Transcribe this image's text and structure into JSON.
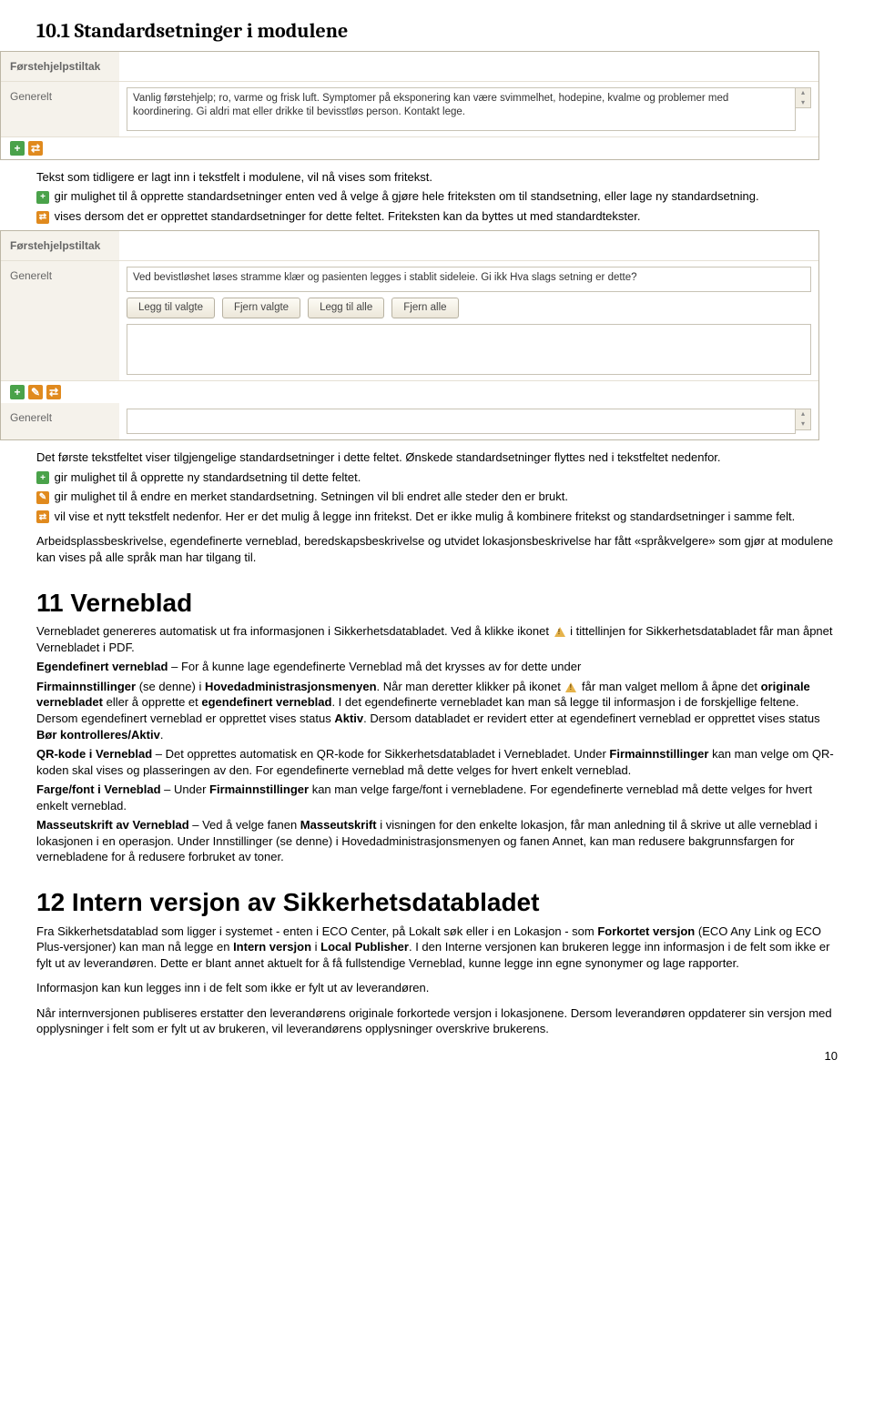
{
  "section_10_1": {
    "heading": "10.1 Standardsetninger i modulene",
    "panel1": {
      "title_label": "Førstehjelpstiltak",
      "row_label": "Generelt",
      "textarea": "Vanlig førstehjelp; ro, varme og frisk luft. Symptomer på eksponering kan være svimmelhet, hodepine, kvalme og problemer med koordinering. Gi aldri mat eller drikke til bevisstløs person. Kontakt lege."
    },
    "p1": "Tekst som tidligere er lagt inn i tekstfelt i modulene, vil nå vises som fritekst.",
    "p2a": " gir mulighet til å opprette standardsetninger enten ved å velge å gjøre hele friteksten om til standsetning, eller lage ny standardsetning.",
    "p3a": " vises dersom det er opprettet standardsetninger for dette feltet. Friteksten kan da byttes ut med standardtekster.",
    "panel2": {
      "title_label": "Førstehjelpstiltak",
      "row_label": "Generelt",
      "textarea": "Ved bevistløshet løses stramme klær og pasienten legges i stablit sideleie. Gi ikk Hva slags setning er dette?",
      "btn1": "Legg til valgte",
      "btn2": "Fjern valgte",
      "btn3": "Legg til alle",
      "btn4": "Fjern alle",
      "row_label2": "Generelt"
    },
    "p4": "Det første tekstfeltet viser tilgjengelige standardsetninger i dette feltet. Ønskede standardsetninger flyttes ned i tekstfeltet nedenfor.",
    "p5": " gir mulighet til å opprette ny standardsetning til dette feltet.",
    "p6": " gir mulighet til å endre en merket standardsetning. Setningen vil bli endret alle steder den er brukt.",
    "p7": " vil vise et nytt tekstfelt nedenfor. Her er det mulig å legge inn fritekst. Det er ikke mulig å kombinere fritekst og standardsetninger i samme felt.",
    "p8": "Arbeidsplassbeskrivelse, egendefinerte verneblad, beredskapsbeskrivelse og utvidet lokasjonsbeskrivelse har fått «språkvelgere» som gjør at modulene kan vises på alle språk man har tilgang til."
  },
  "section_11": {
    "heading": "11 Verneblad",
    "p1a": "Vernebladet genereres automatisk ut fra informasjonen i Sikkerhetsdatabladet. Ved å klikke ikonet ",
    "p1b": " i tittellinjen for Sikkerhetsdatabladet får man åpnet Vernebladet i PDF.",
    "p2_b": "Egendefinert verneblad",
    "p2": " – For å kunne lage egendefinerte Verneblad må det krysses av for dette under ",
    "p3_b1": "Firmainnstillinger",
    "p3a": " (se denne) i ",
    "p3_b2": "Hovedadministrasjonsmenyen",
    "p3b": ". Når man deretter klikker på ikonet ",
    "p3c": " får man valget mellom å åpne det ",
    "p3_b3": "originale vernebladet",
    "p3d": " eller å opprette et ",
    "p3_b4": "egendefinert verneblad",
    "p3e": ". I det egendefinerte vernebladet kan man så legge til informasjon i de forskjellige feltene. Dersom egendefinert verneblad er opprettet vises status ",
    "p3_b5": "Aktiv",
    "p3f": ". Dersom databladet er revidert etter at egendefinert verneblad er opprettet vises status ",
    "p3_b6": "Bør kontrolleres/Aktiv",
    "p3g": ".",
    "p4_b": "QR-kode i Verneblad",
    "p4a": " – Det opprettes automatisk en QR-kode for Sikkerhetsdatabladet i Vernebladet. Under ",
    "p4_b2": "Firmainnstillinger",
    "p4b": " kan man velge om QR-koden skal vises og plasseringen av den. For egendefinerte verneblad må dette velges for hvert enkelt verneblad.",
    "p5_b": "Farge/font i Verneblad",
    "p5a": " – Under ",
    "p5_b2": "Firmainnstillinger",
    "p5b": " kan man velge farge/font i vernebladene. For egendefinerte verneblad må dette velges for hvert enkelt verneblad.",
    "p6_b": "Masseutskrift av Verneblad",
    "p6a": " – Ved å velge fanen ",
    "p6_b2": "Masseutskrift",
    "p6b": " i visningen for den enkelte lokasjon, får man anledning til å skrive ut alle verneblad i lokasjonen i en operasjon. Under Innstillinger (se denne) i Hovedadministrasjonsmenyen og fanen Annet, kan man redusere bakgrunnsfargen for vernebladene for å redusere forbruket av toner."
  },
  "section_12": {
    "heading": "12 Intern versjon av Sikkerhetsdatabladet",
    "p1a": "Fra Sikkerhetsdatablad som ligger i systemet - enten i ECO Center, på Lokalt søk eller i en Lokasjon - som ",
    "p1_b1": "Forkortet versjon",
    "p1b": " (ECO Any Link og ECO Plus-versjoner) kan man nå legge en ",
    "p1_b2": "Intern versjon",
    "p1c": " i ",
    "p1_b3": "Local Publisher",
    "p1d": ". I den Interne versjonen kan brukeren legge inn informasjon i de felt som ikke er fylt ut av leverandøren. Dette er blant annet aktuelt for å få fullstendige Verneblad, kunne legge inn egne synonymer og lage rapporter.",
    "p2": "Informasjon kan kun legges inn i de felt som ikke er fylt ut av leverandøren.",
    "p3": "Når internversjonen publiseres erstatter den leverandørens originale forkortede versjon i lokasjonene. Dersom leverandøren oppdaterer sin versjon med opplysninger i felt som er fylt ut av brukeren, vil leverandørens opplysninger overskrive brukerens."
  },
  "page_number": "10"
}
